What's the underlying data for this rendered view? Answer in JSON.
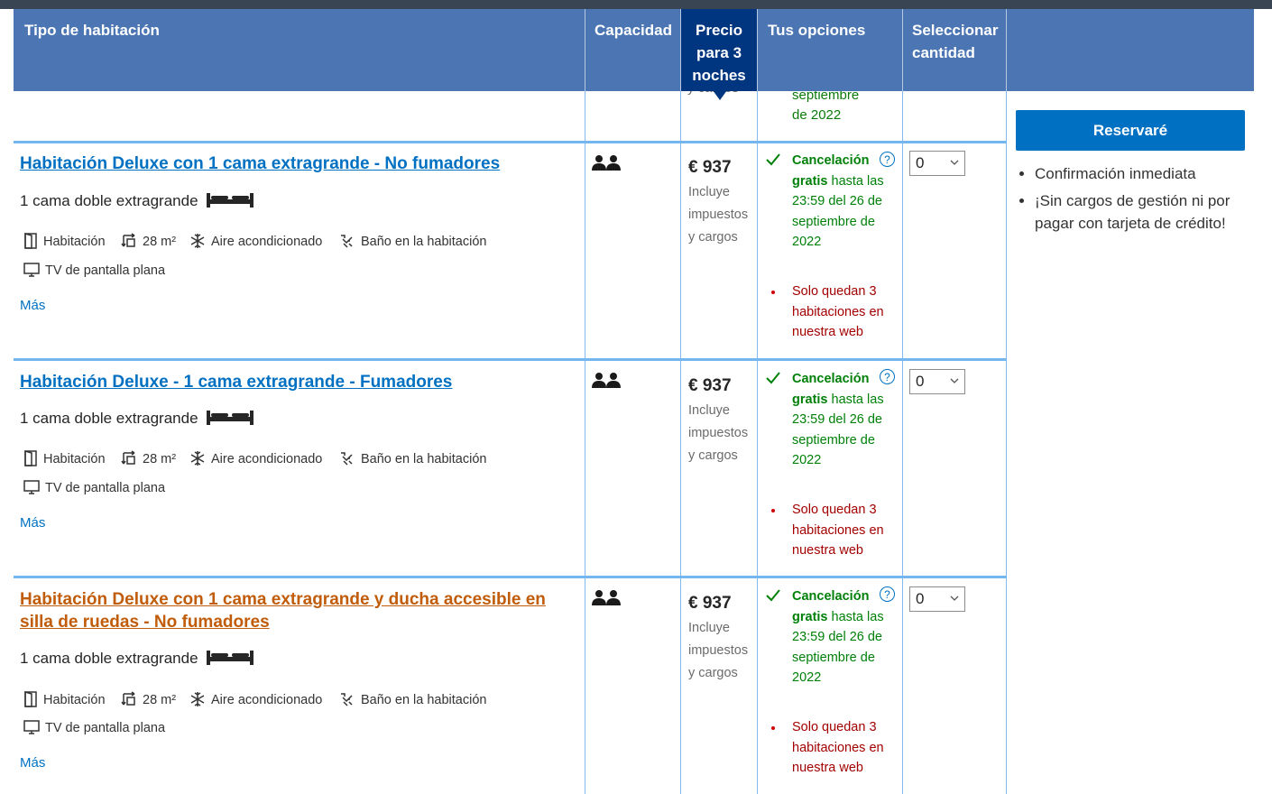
{
  "header": {
    "room_type": "Tipo de habitación",
    "capacity": "Capacidad",
    "price": "Precio para 3 noches",
    "options": "Tus opciones",
    "select_qty": "Seleccionar cantidad"
  },
  "top_partial": {
    "price_note": "y cargos",
    "cancel_line1": "septiembre",
    "cancel_line2": "de 2022"
  },
  "rooms": [
    {
      "title": "Habitación Deluxe con 1 cama extragrande - No fumadores",
      "bed": "1 cama doble extragrande",
      "facilities": [
        "Habitación",
        "28 m²",
        "Aire acondicionado",
        "Baño en la habitación",
        "TV de pantalla plana"
      ],
      "more": "Más",
      "price": "€ 937",
      "price_note": "Incluye impuestos y cargos",
      "cancel_bold": "Cancelación gratis",
      "cancel_rest": " hasta las 23:59 del 26 de septiembre de 2022",
      "scarcity": "Solo quedan 3 habitaciones en nuestra web",
      "qty": "0"
    },
    {
      "title": "Habitación Deluxe - 1 cama extragrande - Fumadores",
      "bed": "1 cama doble extragrande",
      "facilities": [
        "Habitación",
        "28 m²",
        "Aire acondicionado",
        "Baño en la habitación",
        "TV de pantalla plana"
      ],
      "more": "Más",
      "price": "€ 937",
      "price_note": "Incluye impuestos y cargos",
      "cancel_bold": "Cancelación gratis",
      "cancel_rest": " hasta las 23:59 del 26 de septiembre de 2022",
      "scarcity": "Solo quedan 3 habitaciones en nuestra web",
      "qty": "0"
    },
    {
      "title": "Habitación Deluxe con 1 cama extragrande y ducha accesible en silla de ruedas - No fumadores",
      "bed": "1 cama doble extragrande",
      "facilities": [
        "Habitación",
        "28 m²",
        "Aire acondicionado",
        "Baño en la habitación",
        "TV de pantalla plana"
      ],
      "more": "Más",
      "price": "€ 937",
      "price_note": "Incluye impuestos y cargos",
      "cancel_bold": "Cancelación gratis",
      "cancel_rest": " hasta las 23:59 del 26 de septiembre de 2022",
      "scarcity": "Solo quedan 3 habitaciones en nuestra web",
      "qty": "0"
    }
  ],
  "sidebar": {
    "reserve_button": "Reservaré",
    "benefits": [
      "Confirmación inmediata",
      "¡Sin cargos de gestión ni por pagar con tarjeta de crédito!"
    ]
  },
  "icons": {
    "people": "two-people-icon",
    "bed": "bed-icon",
    "room": "door-icon",
    "size": "area-icon",
    "ac": "snowflake-icon",
    "bath": "bath-icon",
    "tv": "tv-icon",
    "check": "check-icon",
    "help": "question-icon"
  },
  "colors": {
    "header_bg": "#4b76b3",
    "price_header_bg": "#003580",
    "link": "#0071c2",
    "visited_link": "#c05c0a",
    "green": "#008009",
    "red": "#a30000",
    "divider": "#74b6f0"
  }
}
